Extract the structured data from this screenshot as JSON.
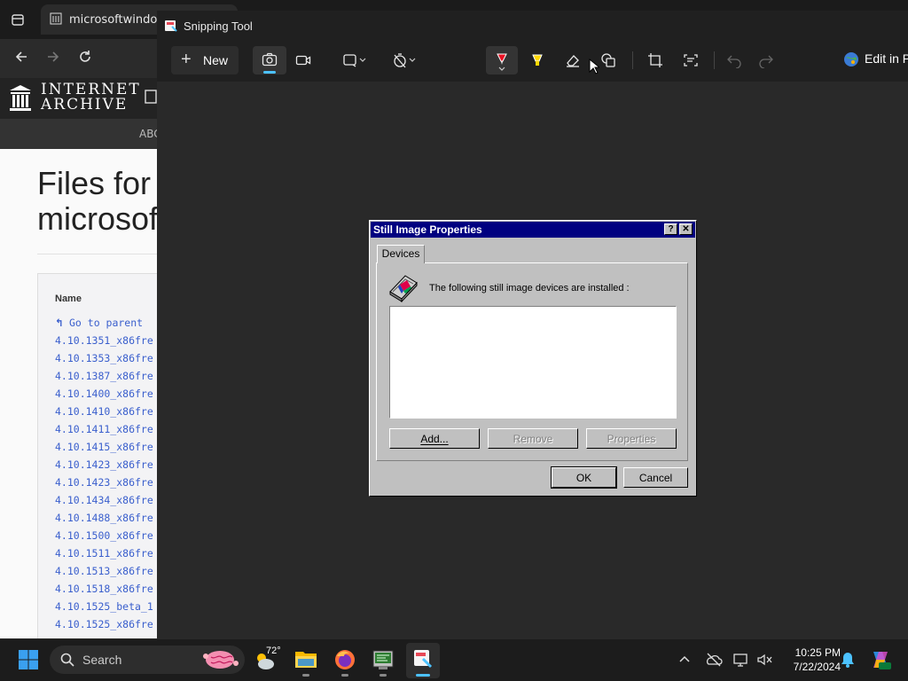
{
  "browser": {
    "tab_title": "microsoftwindows",
    "site_logo_line1": "INTERNET",
    "site_logo_line2": "ARCHIVE",
    "subnav_label": "ABC",
    "page_title_line1": "Files for",
    "page_title_line2": "microsof",
    "table_header": "Name",
    "go_to_parent": "Go to parent",
    "files": [
      "4.10.1351_x86fre",
      "4.10.1353_x86fre",
      "4.10.1387_x86fre",
      "4.10.1400_x86fre",
      "4.10.1410_x86fre",
      "4.10.1411_x86fre",
      "4.10.1415_x86fre",
      "4.10.1423_x86fre",
      "4.10.1423_x86fre",
      "4.10.1434_x86fre",
      "4.10.1488_x86fre",
      "4.10.1500_x86fre",
      "4.10.1511_x86fre",
      "4.10.1513_x86fre",
      "4.10.1518_x86fre",
      "4.10.1525_beta_1",
      "4.10.1525_x86fre"
    ]
  },
  "snipping_tool": {
    "title": "Snipping Tool",
    "new_label": "New",
    "edit_in_label": "Edit in P",
    "accent_color": "#4cc2ff"
  },
  "dialog": {
    "title": "Still Image Properties",
    "help_glyph": "?",
    "close_glyph": "✕",
    "tab_label": "Devices",
    "description": "The following still image devices are installed :",
    "add_label": "Add...",
    "remove_label": "Remove",
    "properties_label": "Properties",
    "ok_label": "OK",
    "cancel_label": "Cancel"
  },
  "taskbar": {
    "search_label": "Search",
    "weather_temp": "72°",
    "time": "10:25 PM",
    "date": "7/22/2024"
  }
}
